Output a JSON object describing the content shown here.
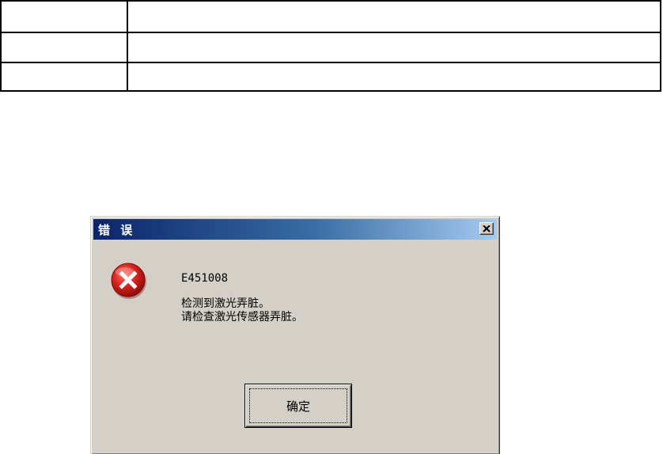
{
  "top_table": {
    "rows": [
      [
        "",
        ""
      ],
      [
        "",
        ""
      ],
      [
        "",
        ""
      ]
    ]
  },
  "dialog": {
    "title": "错 误",
    "close_icon": "close-icon",
    "icon": "error-icon",
    "error_code": "E451008",
    "lines": [
      "检测到激光弄脏。",
      "请检查激光传感器弄脏。"
    ],
    "ok_label": "确定"
  },
  "colors": {
    "titlebar_start": "#0a246a",
    "titlebar_end": "#a6caf0",
    "dialog_face": "#d4d0c8",
    "error_red": "#d9201c"
  }
}
